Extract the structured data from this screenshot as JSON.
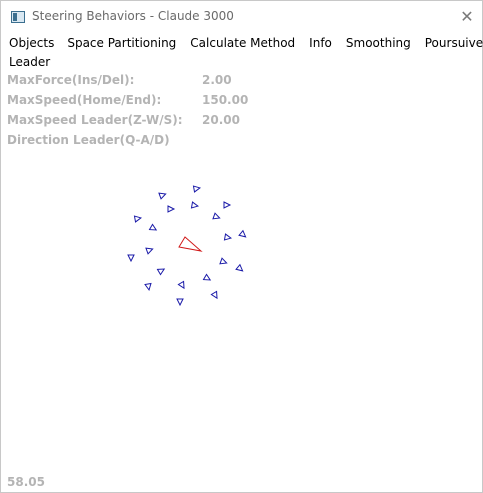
{
  "window": {
    "title": "Steering Behaviors - Claude 3000",
    "close_glyph": "✕"
  },
  "menu": {
    "row1": [
      "Objects",
      "Space Partitioning",
      "Calculate Method",
      "Info",
      "Smoothing",
      "Poursuiveurs"
    ],
    "row2": [
      "Leader"
    ]
  },
  "params": [
    {
      "label": "MaxForce(Ins/Del):",
      "value": "2.00"
    },
    {
      "label": "MaxSpeed(Home/End):",
      "value": "150.00"
    },
    {
      "label": "MaxSpeed Leader(Z-W/S):",
      "value": "20.00"
    },
    {
      "label": "Direction Leader(Q-A/D)",
      "value": ""
    }
  ],
  "fps": "58.05",
  "colors": {
    "follower": "#1a1aa8",
    "leader": "#d01818",
    "params_text": "#b4b4b4"
  },
  "icons": {
    "app": "app-window-icon",
    "close": "close-icon"
  }
}
